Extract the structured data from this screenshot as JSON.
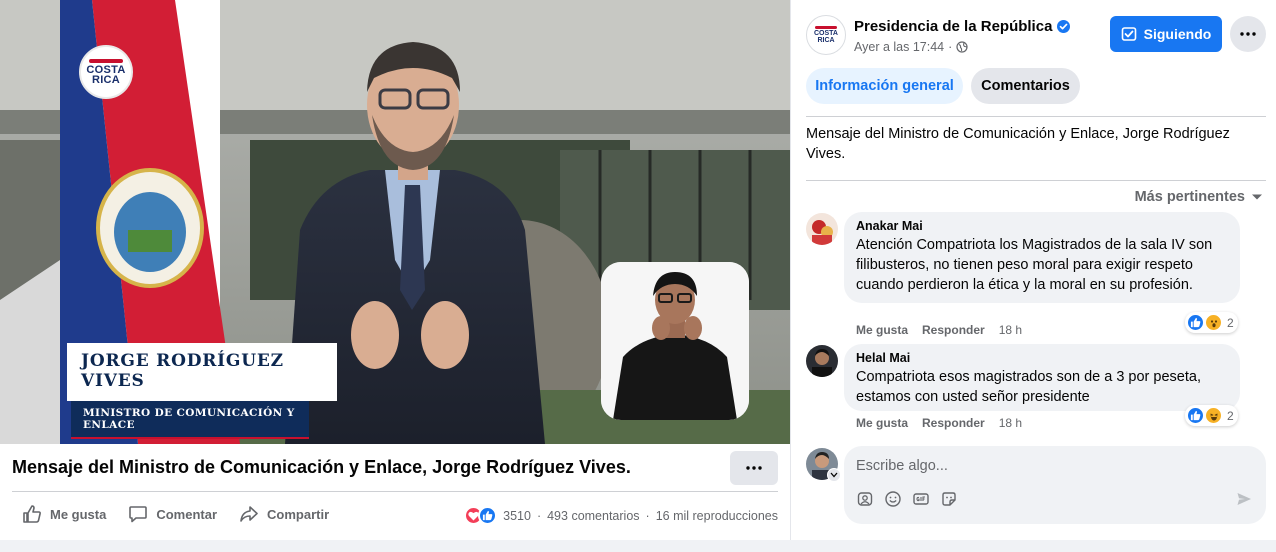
{
  "video": {
    "badge": {
      "line1": "COSTA",
      "line2": "RICA"
    },
    "lower_third": {
      "name": "JORGE RODRÍGUEZ VIVES",
      "role": "MINISTRO DE COMUNICACIÓN Y ENLACE"
    }
  },
  "post": {
    "title": "Mensaje del Ministro de Comunicación y Enlace, Jorge Rodríguez Vives.",
    "actions": {
      "like": "Me gusta",
      "comment": "Comentar",
      "share": "Compartir"
    },
    "stats": {
      "reaction_count": "3510",
      "comments": "493 comentarios",
      "views": "16 mil reproducciones",
      "separator": "·"
    }
  },
  "panel": {
    "page_avatar": {
      "line1": "COSTA",
      "line2": "RICA"
    },
    "page_name": "Presidencia de la República",
    "timestamp": "Ayer a las 17:44",
    "meta_separator": "·",
    "follow_label": "Siguiendo",
    "tabs": [
      {
        "label": "Información general",
        "active": true
      },
      {
        "label": "Comentarios",
        "active": false
      }
    ],
    "description": "Mensaje del Ministro de Comunicación y Enlace, Jorge Rodríguez Vives.",
    "sort_label": "Más pertinentes",
    "comments": [
      {
        "author": "Anakar Mai",
        "text": "Atención Compatriota los Magistrados de la sala IV son filibusteros, no tienen peso moral para exigir respeto cuando perdieron la ética y la moral en su profesión.",
        "like": "Me gusta",
        "reply": "Responder",
        "time": "18 h",
        "reaction_count": "2",
        "reactions": [
          "like-icon",
          "wow-icon"
        ]
      },
      {
        "author": "Helal Mai",
        "text": "Compatriota esos magistrados son de a 3 por peseta, estamos con usted señor presidente",
        "like": "Me gusta",
        "reply": "Responder",
        "time": "18 h",
        "reaction_count": "2",
        "reactions": [
          "like-icon",
          "haha-icon"
        ]
      }
    ],
    "composer": {
      "placeholder": "Escribe algo..."
    }
  },
  "colors": {
    "accent": "#1877f2",
    "secondary_text": "#65676b",
    "bubble": "#f0f2f5",
    "love": "#f33e58",
    "wow": "#f7b125"
  }
}
